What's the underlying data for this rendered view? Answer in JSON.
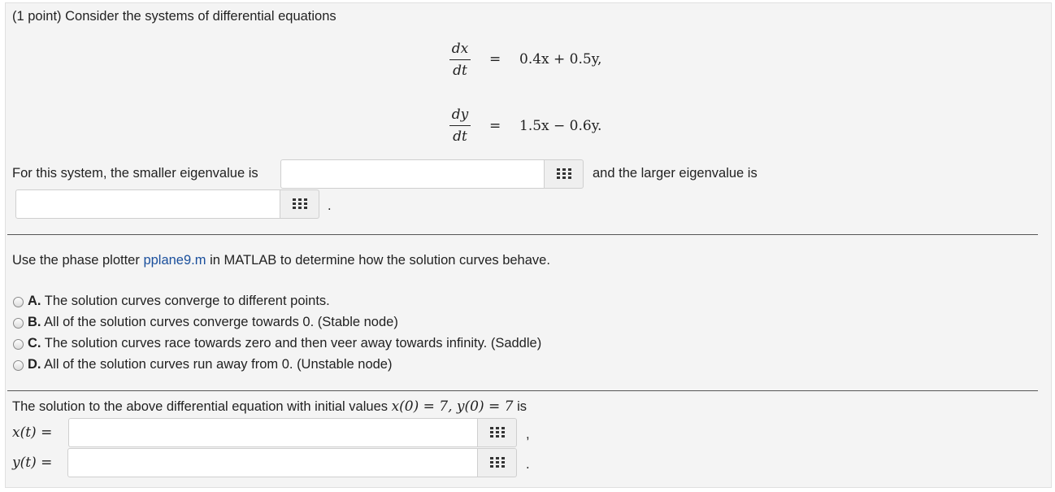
{
  "problem": {
    "intro": "(1 point) Consider the systems of differential equations",
    "eq1": {
      "num": "dx",
      "den": "dt",
      "eq": "=",
      "rhs": "0.4x + 0.5y,"
    },
    "eq2": {
      "num": "dy",
      "den": "dt",
      "eq": "=",
      "rhs": "1.5x − 0.6y."
    }
  },
  "eigen": {
    "prefix": "For this system, the smaller eigenvalue is",
    "middle": "and the larger eigenvalue is",
    "end": ".",
    "smaller_value": "",
    "larger_value": ""
  },
  "phase": {
    "before_link": "Use the phase plotter ",
    "link": "pplane9.m",
    "after_link": " in MATLAB to determine how the solution curves behave.",
    "options": [
      {
        "letter": "A.",
        "text": " The solution curves converge to different points."
      },
      {
        "letter": "B.",
        "text": " All of the solution curves converge towards 0. (Stable node)"
      },
      {
        "letter": "C.",
        "text": " The solution curves race towards zero and then veer away towards infinity. (Saddle)"
      },
      {
        "letter": "D.",
        "text": " All of the solution curves run away from 0. (Unstable node)"
      }
    ]
  },
  "solution": {
    "prefix": "The solution to the above differential equation with initial values ",
    "math": "x(0) = 7,  y(0) = 7",
    "suffix": " is",
    "x_label": "x(t) =",
    "y_label": "y(t) =",
    "x_end": ",",
    "y_end": ".",
    "x_value": "",
    "y_value": ""
  },
  "icons": {
    "matrix": "grid-icon"
  }
}
